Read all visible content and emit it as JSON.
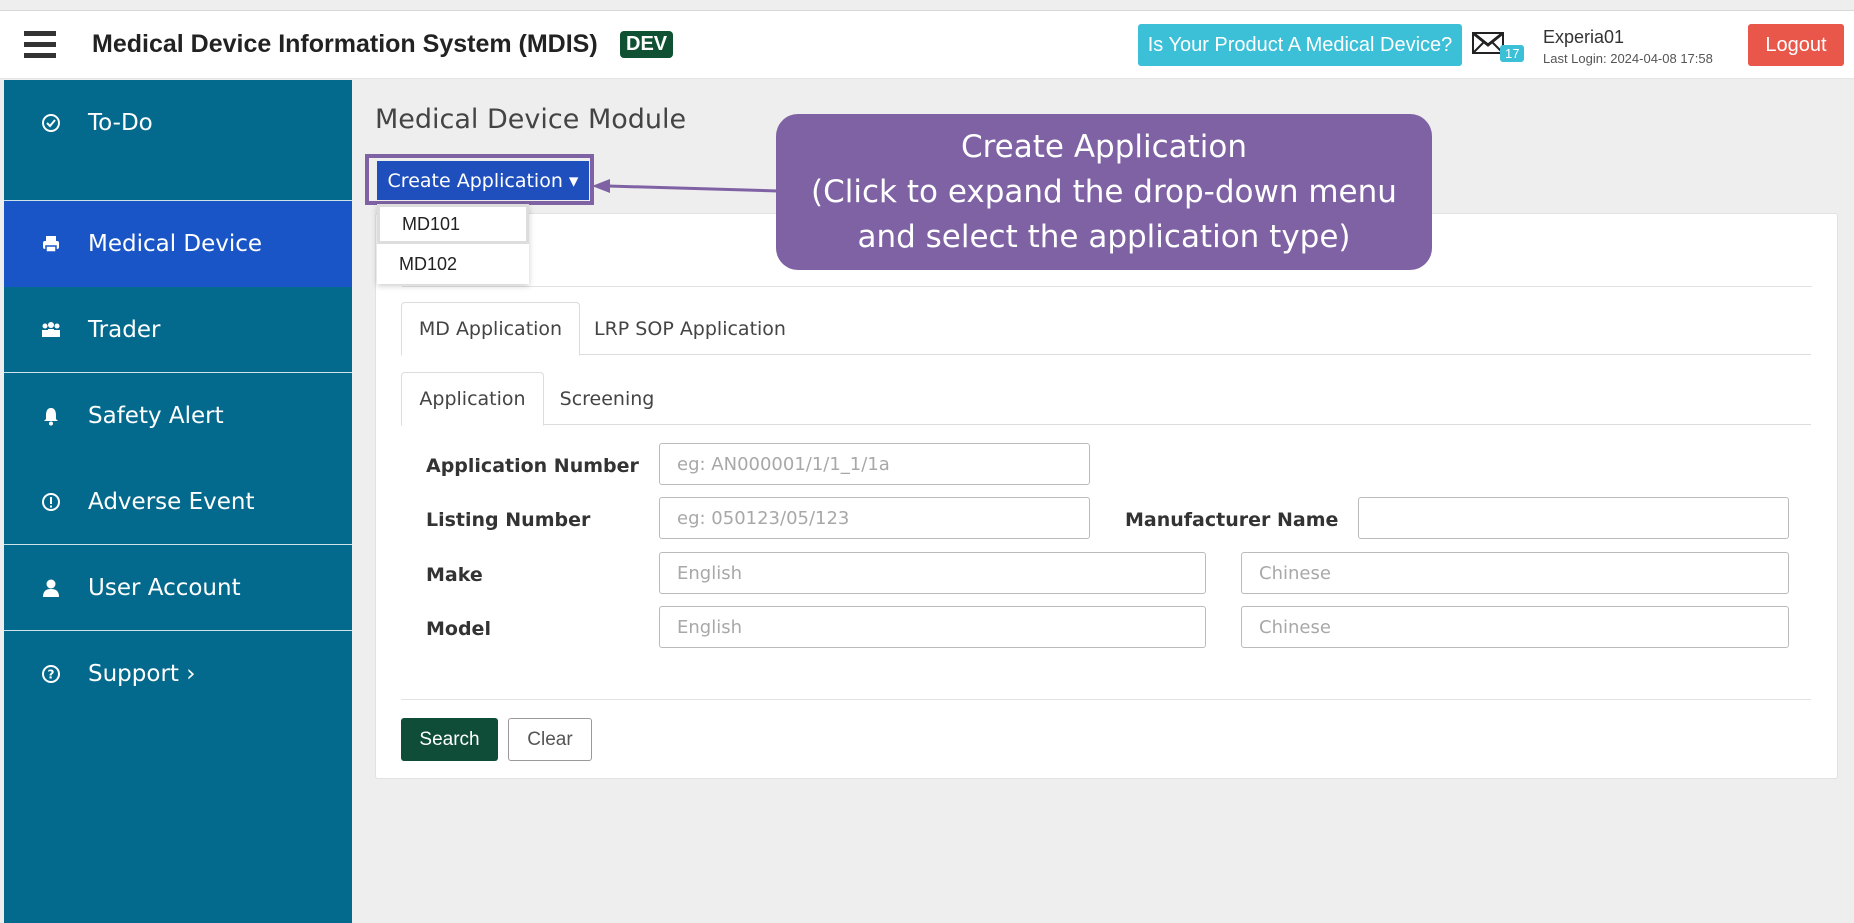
{
  "header": {
    "title": "Medical Device Information System (MDIS)",
    "env_badge": "DEV",
    "product_question": "Is Your Product A Medical Device?",
    "mail_count": "17",
    "user_name": "Experia01",
    "last_login": "Last Login: 2024-04-08 17:58",
    "logout": "Logout"
  },
  "sidebar": {
    "items": [
      {
        "label": "To-Do",
        "icon": "check-circle-icon"
      },
      {
        "label": "Medical Device",
        "icon": "printer-icon",
        "active": true
      },
      {
        "label": "Trader",
        "icon": "users-icon"
      },
      {
        "label": "Safety Alert",
        "icon": "bell-icon"
      },
      {
        "label": "Adverse Event",
        "icon": "exclamation-circle-icon"
      },
      {
        "label": "User Account",
        "icon": "user-icon"
      },
      {
        "label": "Support  ›",
        "icon": "question-circle-icon"
      }
    ]
  },
  "main": {
    "module_title": "Medical Device Module",
    "create_button": "Create Application ▾",
    "dropdown_options": [
      "MD101",
      "MD102"
    ],
    "callout": {
      "line1": "Create Application",
      "line2": "(Click to expand the drop-down menu",
      "line3": "and select the application type)"
    },
    "tabs_primary": [
      "MD Application",
      "LRP SOP Application"
    ],
    "tabs_secondary": [
      "Application",
      "Screening"
    ],
    "form": {
      "application_number_label": "Application Number",
      "application_number_placeholder": "eg: AN000001/1/1_1/1a",
      "listing_number_label": "Listing Number",
      "listing_number_placeholder": "eg: 050123/05/123",
      "manufacturer_name_label": "Manufacturer Name",
      "make_label": "Make",
      "make_english_placeholder": "English",
      "make_chinese_placeholder": "Chinese",
      "model_label": "Model",
      "model_english_placeholder": "English",
      "model_chinese_placeholder": "Chinese"
    },
    "search_button": "Search",
    "clear_button": "Clear"
  },
  "colors": {
    "sidebar_bg": "#046a8d",
    "sidebar_active": "#1a55c8",
    "callout_bg": "#7f62a3",
    "primary_button": "#1f4fbd",
    "search_button": "#0f4d38",
    "logout_button": "#e8574a",
    "info_button": "#3bc0d8"
  }
}
